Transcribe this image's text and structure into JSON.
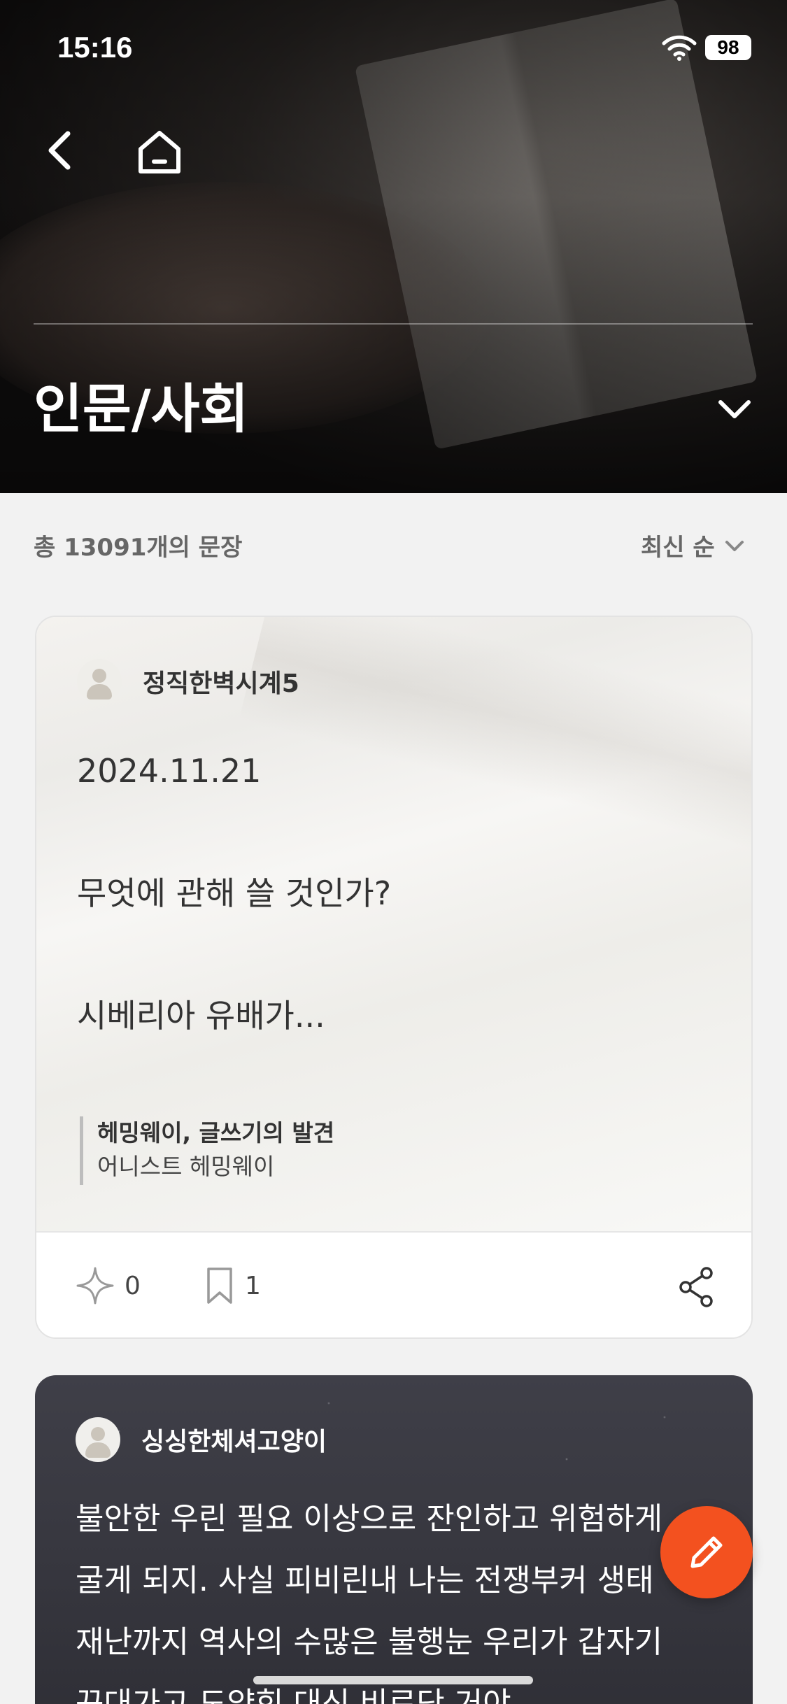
{
  "status_bar": {
    "time": "15:16",
    "battery": "98"
  },
  "header": {
    "category_title": "인문/사회"
  },
  "list": {
    "summary": "총 13091개의 문장",
    "sort_label": "최신 순"
  },
  "cards": [
    {
      "author": "정직한벽시계5",
      "lines": [
        "2024.11.21",
        "무엇에 관해 쓸 것인가?",
        "시베리아 유배가..."
      ],
      "book_title": "헤밍웨이, 글쓰기의 발견",
      "book_author": "어니스트 헤밍웨이",
      "like_count": "0",
      "bookmark_count": "1"
    },
    {
      "author": "싱싱한체셔고양이",
      "lines": [
        "불안한 우린 필요 이상으로 잔인하고 위험하게",
        "굴게 되지. 사실 피비린내 나는 전쟁부커 생태",
        "재난까지 역사의 수많은 불행눈 우리가 갑자기",
        "꾸대가고 도약힌 대신 비로단 거야"
      ]
    }
  ],
  "icons": {
    "back": "chevron-left-icon",
    "home": "home-icon",
    "dropdown": "chevron-down-icon",
    "like": "sparkle-icon",
    "bookmark": "bookmark-icon",
    "share": "share-icon",
    "write": "pencil-icon"
  },
  "colors": {
    "accent": "#f3511f",
    "dark_card": "#3a3a42"
  }
}
